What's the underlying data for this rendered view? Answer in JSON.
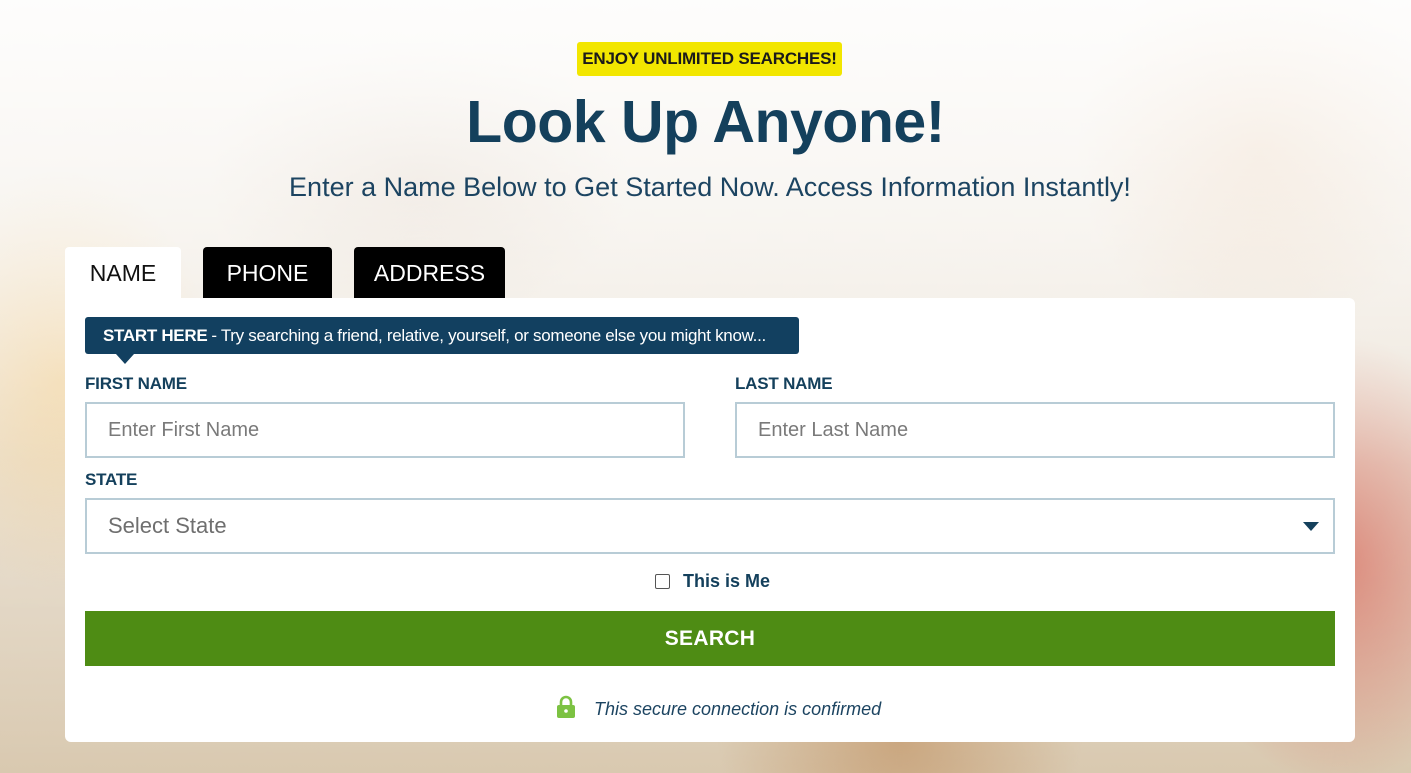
{
  "promo_badge": "ENJOY UNLIMITED SEARCHES!",
  "title": "Look Up Anyone!",
  "subtitle": "Enter a Name Below to Get Started Now. Access Information Instantly!",
  "tabs": [
    {
      "label": "NAME",
      "active": true
    },
    {
      "label": "PHONE",
      "active": false
    },
    {
      "label": "ADDRESS",
      "active": false
    }
  ],
  "tip": {
    "strong": "START HERE",
    "text": "- Try searching a friend, relative, yourself, or someone else you might know..."
  },
  "form": {
    "first_name_label": "FIRST NAME",
    "first_name_placeholder": "Enter First Name",
    "last_name_label": "LAST NAME",
    "last_name_placeholder": "Enter Last Name",
    "state_label": "STATE",
    "state_selected": "Select State",
    "this_is_me_label": "This is Me",
    "this_is_me_checked": false,
    "search_button": "SEARCH"
  },
  "secure_text": "This secure connection is confirmed",
  "icons": {
    "secure": "lock-icon",
    "state_dropdown": "chevron-down-icon"
  },
  "colors": {
    "primary_navy": "#14405c",
    "promo_yellow": "#f2e600",
    "search_green": "#4e8c14",
    "lock_green": "#7cc242"
  }
}
